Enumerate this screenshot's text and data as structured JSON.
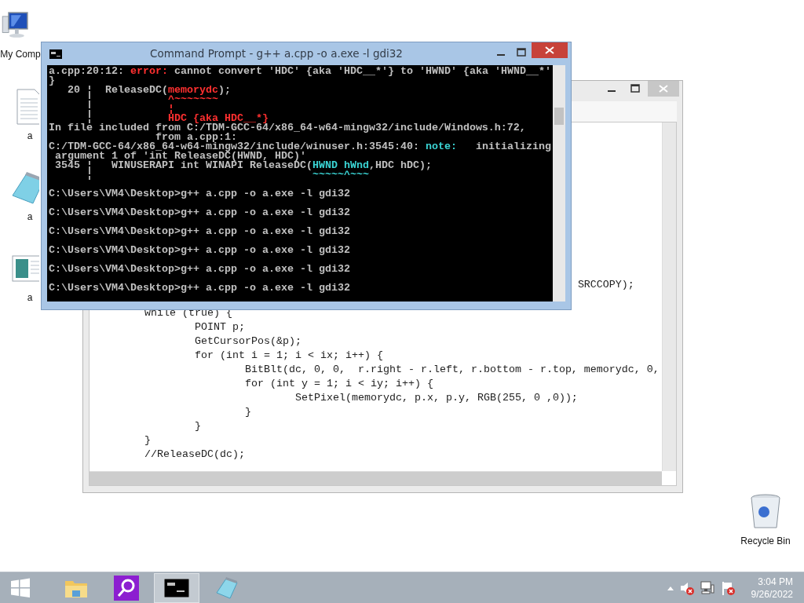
{
  "desktop_icons": [
    {
      "kind": "computer",
      "label": "My Comp"
    },
    {
      "kind": "text-file",
      "label": "a"
    },
    {
      "kind": "notepad",
      "label": "a"
    },
    {
      "kind": "document",
      "label": "a"
    },
    {
      "kind": "recycle-bin",
      "label": "Recycle Bin"
    }
  ],
  "editor": {
    "lines": [
      {
        "kind": "code",
        "text": "\t\t\t\t\t\t\t\t\t     SRCCOPY);"
      },
      {
        "kind": "blank"
      },
      {
        "kind": "code",
        "text": "\twhile (true) {"
      },
      {
        "kind": "code",
        "text": "\t\tPOINT p;"
      },
      {
        "kind": "code",
        "text": "\t\tGetCursorPos(&p);"
      },
      {
        "kind": "code",
        "text": "\t\tfor (int i = 1; i < ix; i++) {"
      },
      {
        "kind": "code",
        "text": "\t\t\tBitBlt(dc, 0, 0,  r.right - r.left, r.bottom - r.top, memorydc, 0,"
      },
      {
        "kind": "code",
        "text": "\t\t\tfor (int y = 1; i < iy; i++) {"
      },
      {
        "kind": "code",
        "text": "\t\t\t\tSetPixel(memorydc, p.x, p.y, RGB(255, 0 ,0));"
      },
      {
        "kind": "code",
        "text": "\t\t\t}"
      },
      {
        "kind": "code",
        "text": "\t\t}"
      },
      {
        "kind": "code",
        "text": "\t}"
      },
      {
        "kind": "code",
        "text": "\t//ReleaseDC(dc);"
      }
    ]
  },
  "console": {
    "title": "Command Prompt - g++  a.cpp -o a.exe -l gdi32",
    "lines": [
      {
        "kind": "text",
        "segments": [
          {
            "kind": "plain",
            "text": "a.cpp:20:12: "
          },
          {
            "kind": "error",
            "text": "error:"
          },
          {
            "kind": "plain",
            "text": " cannot convert 'HDC' {aka 'HDC__*'} to 'HWND' {aka 'HWND__*'"
          }
        ]
      },
      {
        "kind": "text",
        "segments": [
          {
            "kind": "plain",
            "text": "}"
          }
        ]
      },
      {
        "kind": "text",
        "segments": [
          {
            "kind": "plain",
            "text": "   20 ¦  ReleaseDC("
          },
          {
            "kind": "error",
            "text": "memorydc"
          },
          {
            "kind": "plain",
            "text": ");"
          }
        ]
      },
      {
        "kind": "text",
        "segments": [
          {
            "kind": "plain",
            "text": "      ¦            "
          },
          {
            "kind": "error",
            "text": "^~~~~~~~"
          }
        ]
      },
      {
        "kind": "text",
        "segments": [
          {
            "kind": "plain",
            "text": "      ¦            "
          },
          {
            "kind": "error",
            "text": "¦"
          }
        ]
      },
      {
        "kind": "text",
        "segments": [
          {
            "kind": "plain",
            "text": "      ¦            "
          },
          {
            "kind": "error",
            "text": "HDC {aka HDC__*}"
          }
        ]
      },
      {
        "kind": "text",
        "segments": [
          {
            "kind": "plain",
            "text": "In file included from C:/TDM-GCC-64/x86_64-w64-mingw32/include/Windows.h:72,"
          }
        ]
      },
      {
        "kind": "text",
        "segments": [
          {
            "kind": "plain",
            "text": "                 from a.cpp:1:"
          }
        ]
      },
      {
        "kind": "text",
        "segments": [
          {
            "kind": "plain",
            "text": "C:/TDM-GCC-64/x86_64-w64-mingw32/include/winuser.h:3545:40: "
          },
          {
            "kind": "note",
            "text": "note:"
          },
          {
            "kind": "plain",
            "text": "   initializing"
          }
        ]
      },
      {
        "kind": "text",
        "segments": [
          {
            "kind": "plain",
            "text": " argument 1 of 'int ReleaseDC(HWND, HDC)'"
          }
        ]
      },
      {
        "kind": "text",
        "segments": [
          {
            "kind": "plain",
            "text": " 3545 ¦   WINUSERAPI int WINAPI ReleaseDC("
          },
          {
            "kind": "note",
            "text": "HWND hWnd"
          },
          {
            "kind": "plain",
            "text": ",HDC hDC);"
          }
        ]
      },
      {
        "kind": "text",
        "segments": [
          {
            "kind": "plain",
            "text": "      ¦                                   "
          },
          {
            "kind": "note",
            "text": "~~~~~^~~~"
          }
        ]
      },
      {
        "kind": "blank"
      },
      {
        "kind": "text",
        "segments": [
          {
            "kind": "plain",
            "text": "C:\\Users\\VM4\\Desktop>g++ a.cpp -o a.exe -l gdi32"
          }
        ]
      },
      {
        "kind": "blank"
      },
      {
        "kind": "text",
        "segments": [
          {
            "kind": "plain",
            "text": "C:\\Users\\VM4\\Desktop>g++ a.cpp -o a.exe -l gdi32"
          }
        ]
      },
      {
        "kind": "blank"
      },
      {
        "kind": "text",
        "segments": [
          {
            "kind": "plain",
            "text": "C:\\Users\\VM4\\Desktop>g++ a.cpp -o a.exe -l gdi32"
          }
        ]
      },
      {
        "kind": "blank"
      },
      {
        "kind": "text",
        "segments": [
          {
            "kind": "plain",
            "text": "C:\\Users\\VM4\\Desktop>g++ a.cpp -o a.exe -l gdi32"
          }
        ]
      },
      {
        "kind": "blank"
      },
      {
        "kind": "text",
        "segments": [
          {
            "kind": "plain",
            "text": "C:\\Users\\VM4\\Desktop>g++ a.cpp -o a.exe -l gdi32"
          }
        ]
      },
      {
        "kind": "blank"
      },
      {
        "kind": "text",
        "segments": [
          {
            "kind": "plain",
            "text": "C:\\Users\\VM4\\Desktop>g++ a.cpp -o a.exe -l gdi32"
          }
        ]
      }
    ]
  },
  "taskbar": {
    "apps": [
      {
        "kind": "explorer",
        "selected": false
      },
      {
        "kind": "search",
        "selected": false
      },
      {
        "kind": "console",
        "selected": true
      },
      {
        "kind": "notepad",
        "selected": false
      }
    ],
    "time": "3:04 PM",
    "date": "9/26/2022"
  }
}
